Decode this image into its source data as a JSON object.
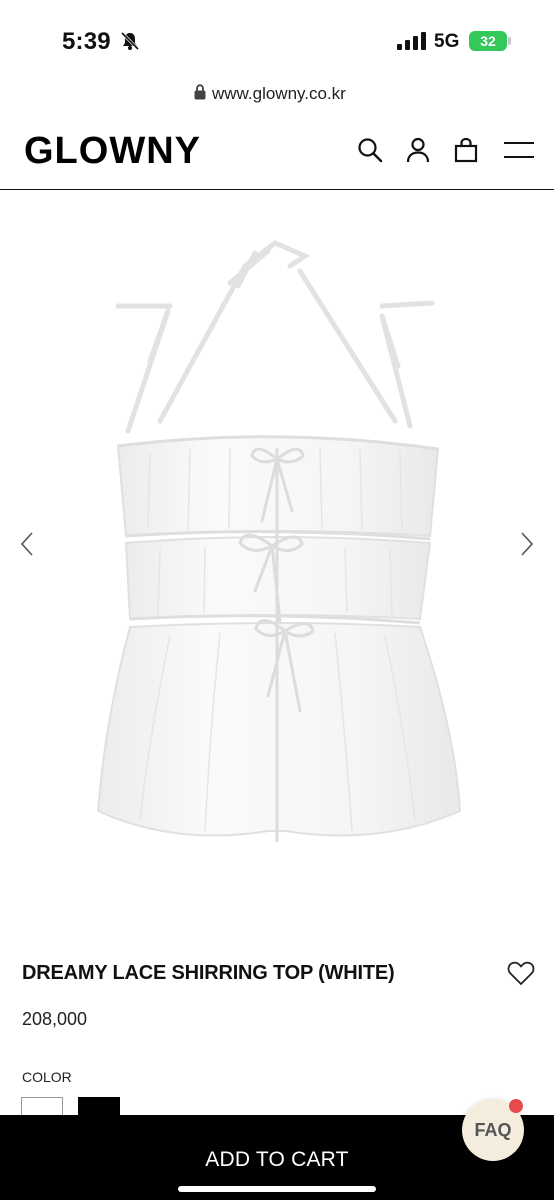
{
  "status_bar": {
    "time": "5:39",
    "network": "5G",
    "battery": "32"
  },
  "browser": {
    "url": "www.glowny.co.kr"
  },
  "header": {
    "logo": "GLOWNY"
  },
  "product": {
    "title": "DREAMY LACE SHIRRING TOP (WHITE)",
    "price": "208,000",
    "color_label": "COLOR",
    "colors": [
      "#ffffff",
      "#000000"
    ]
  },
  "cart": {
    "label": "ADD TO CART"
  },
  "faq": {
    "label": "FAQ"
  },
  "icons": {
    "search": "search-icon",
    "account": "user-icon",
    "bag": "shopping-bag-icon",
    "menu": "hamburger-menu-icon",
    "wishlist": "heart-icon"
  }
}
